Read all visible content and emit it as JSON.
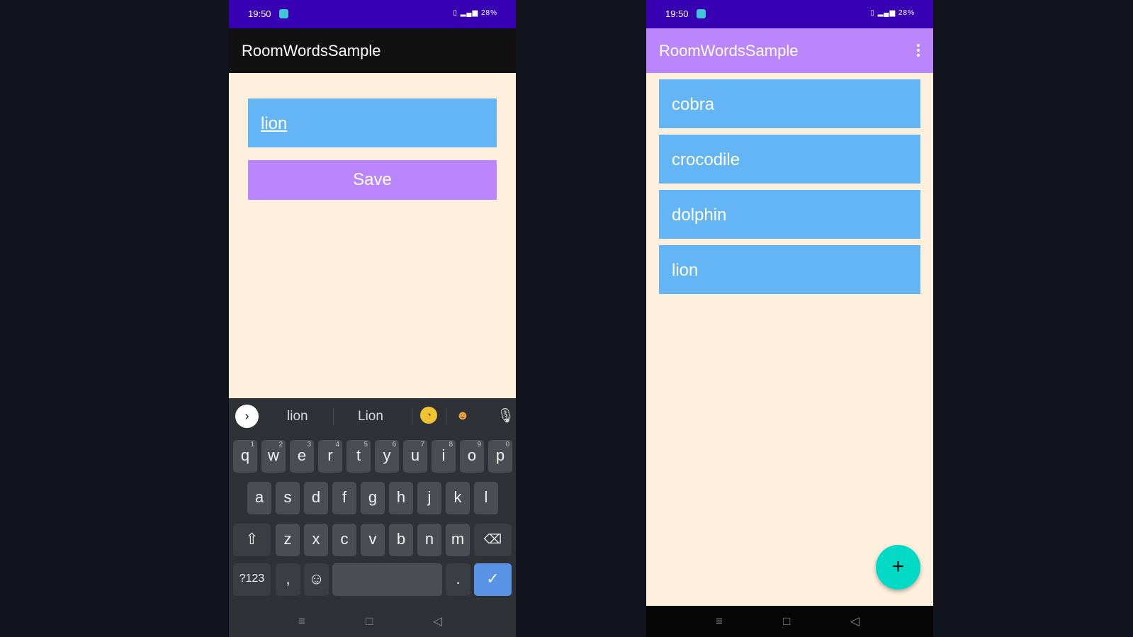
{
  "status_bar": {
    "time": "19:50",
    "battery": "28%"
  },
  "left_screen": {
    "app_title": "RoomWordsSample",
    "input": {
      "value": "lion"
    },
    "save_label": "Save",
    "keyboard": {
      "suggestions": [
        "lion",
        "Lion"
      ],
      "emoji_suggestions": [
        "lion-face-emoji"
      ],
      "row1": [
        {
          "k": "q",
          "h": "1"
        },
        {
          "k": "w",
          "h": "2"
        },
        {
          "k": "e",
          "h": "3"
        },
        {
          "k": "r",
          "h": "4"
        },
        {
          "k": "t",
          "h": "5"
        },
        {
          "k": "y",
          "h": "6"
        },
        {
          "k": "u",
          "h": "7"
        },
        {
          "k": "i",
          "h": "8"
        },
        {
          "k": "o",
          "h": "9"
        },
        {
          "k": "p",
          "h": "0"
        }
      ],
      "row2": [
        "a",
        "s",
        "d",
        "f",
        "g",
        "h",
        "j",
        "k",
        "l"
      ],
      "row3": [
        "z",
        "x",
        "c",
        "v",
        "b",
        "n",
        "m"
      ],
      "symbols_label": "?123",
      "comma_label": ",",
      "period_label": "."
    },
    "nav_icons": [
      "menu-icon",
      "home-icon",
      "back-icon"
    ]
  },
  "right_screen": {
    "app_title": "RoomWordsSample",
    "words": [
      "cobra",
      "crocodile",
      "dolphin",
      "lion"
    ],
    "fab_label": "+"
  },
  "colors": {
    "status_bar": "#3700b3",
    "primary": "#bb86fc",
    "item_background": "#64b5f6",
    "screen_background": "#fef0dd",
    "fab": "#03dac5"
  }
}
